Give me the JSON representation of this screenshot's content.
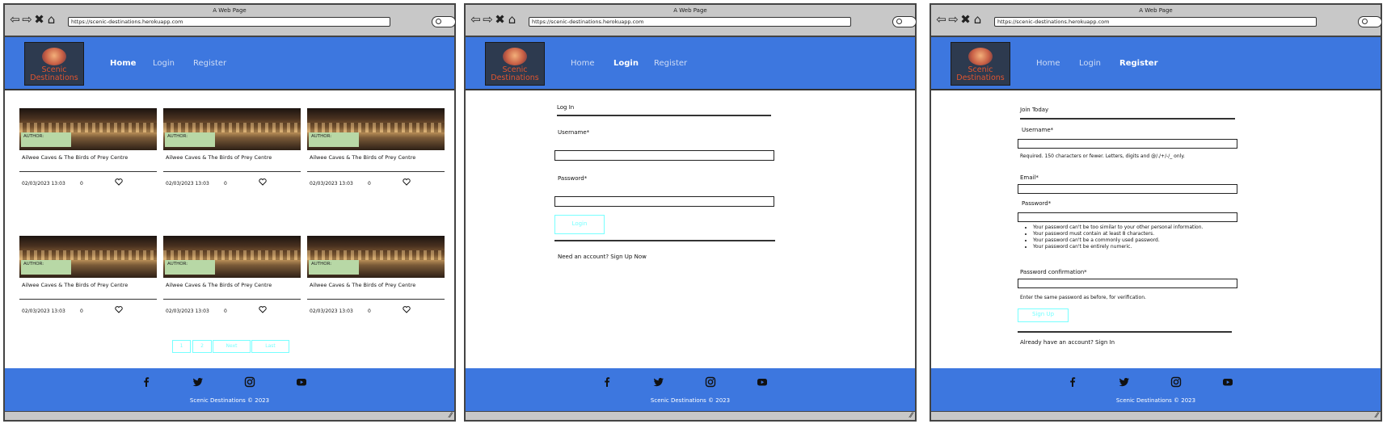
{
  "browser": {
    "window_title": "A Web Page",
    "url": "https://scenic-destinations.herokuapp.com",
    "nav_glyphs": [
      "⇦",
      "⇨",
      "✖",
      "⌂"
    ]
  },
  "site": {
    "brand": "Scenic Destinations",
    "nav": [
      "Home",
      "Login",
      "Register"
    ],
    "footer_text": "Scenic Destinations © 2023",
    "social_icons": [
      "facebook-icon",
      "twitter-icon",
      "instagram-icon",
      "youtube-icon"
    ],
    "colors": {
      "header": "#3d77df",
      "accent": "#77ffff",
      "badge": "#b8d8a6"
    }
  },
  "home": {
    "posts": [
      {
        "author": "AUTHOR:",
        "title": "Ailwee Caves & The Birds of Prey Centre",
        "date": "02/03/2023 13:03",
        "likes": "0"
      },
      {
        "author": "AUTHOR:",
        "title": "Ailwee Caves & The Birds of Prey Centre",
        "date": "02/03/2023 13:03",
        "likes": "0"
      },
      {
        "author": "AUTHOR:",
        "title": "Ailwee Caves & The Birds of Prey Centre",
        "date": "02/03/2023 13:03",
        "likes": "0"
      },
      {
        "author": "AUTHOR:",
        "title": "Ailwee Caves & The Birds of Prey Centre",
        "date": "02/03/2023 13:03",
        "likes": "0"
      },
      {
        "author": "AUTHOR:",
        "title": "Ailwee Caves & The Birds of Prey Centre",
        "date": "02/03/2023 13:03",
        "likes": "0"
      },
      {
        "author": "AUTHOR:",
        "title": "Ailwee Caves & The Birds of Prey Centre",
        "date": "02/03/2023 13:03",
        "likes": "0"
      }
    ],
    "pagination": [
      "1",
      "2",
      "Next",
      "Last"
    ]
  },
  "login": {
    "heading": "Log In",
    "username_label": "Username*",
    "password_label": "Password*",
    "submit": "Login",
    "signup_prompt": "Need an account? Sign Up Now"
  },
  "register": {
    "heading": "Join Today",
    "username_label": "Username*",
    "username_help": "Required. 150 characters or fewer. Letters, digits and @/./+/-/_ only.",
    "email_label": "Email*",
    "password_label": "Password*",
    "password_rules": [
      "Your password can't be too similar to your other personal information.",
      "Your password must contain at least 8 characters.",
      "Your password can't be a commonly used password.",
      "Your password can't be entirely numeric."
    ],
    "confirm_label": "Password confirmation*",
    "confirm_help": "Enter the same password as before, for verification.",
    "submit": "Sign Up",
    "login_prompt": "Already have an account? Sign In"
  }
}
